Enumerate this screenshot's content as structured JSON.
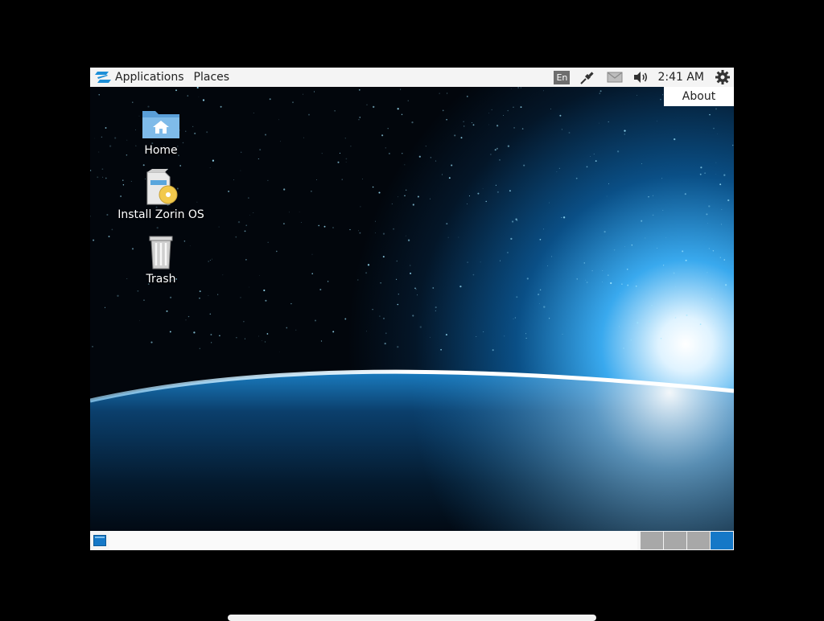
{
  "top_panel": {
    "applications_label": "Applications",
    "places_label": "Places",
    "logo_icon": "zorin-logo-icon",
    "tray": {
      "keyboard_layout": "En",
      "network_icon": "network-wired-icon",
      "mail_icon": "mail-icon",
      "volume_icon": "volume-icon",
      "clock": "2:41 AM",
      "settings_icon": "gear-icon"
    }
  },
  "popup": {
    "about_label": "About"
  },
  "desktop": {
    "icons": [
      {
        "label": "Home",
        "icon": "home-folder-icon"
      },
      {
        "label": "Install Zorin OS",
        "icon": "installer-icon"
      },
      {
        "label": "Trash",
        "icon": "trash-icon"
      }
    ]
  },
  "bottom_panel": {
    "show_desktop_icon": "show-desktop-icon",
    "workspaces": [
      {
        "active": false
      },
      {
        "active": false
      },
      {
        "active": false
      },
      {
        "active": true
      }
    ]
  },
  "colors": {
    "panel_bg": "#f4f4f4",
    "accent": "#1578c7",
    "workspace_inactive": "#a8a8a8"
  }
}
